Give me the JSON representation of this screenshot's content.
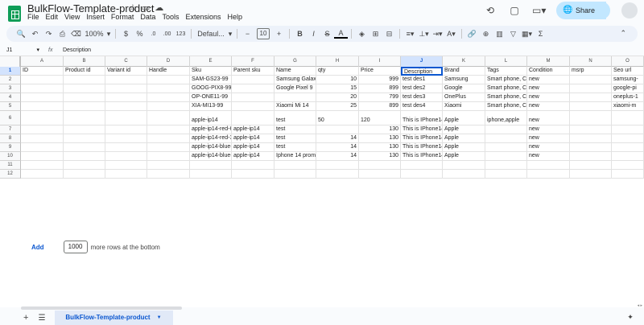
{
  "doc": {
    "title": "BulkFlow-Template-product",
    "menus": [
      "File",
      "Edit",
      "View",
      "Insert",
      "Format",
      "Data",
      "Tools",
      "Extensions",
      "Help"
    ]
  },
  "header": {
    "share_label": "Share"
  },
  "toolbar": {
    "zoom": "100%",
    "currency": "$",
    "percent": "%",
    "dec_dec": ".0",
    "dec_inc": ".00",
    "number_format": "123",
    "font": "Defaul...",
    "font_size": "10",
    "bold": "B",
    "italic": "I",
    "strike": "S",
    "text_color": "A"
  },
  "formula_bar": {
    "cell_ref": "J1",
    "fx": "fx",
    "value": "Description"
  },
  "grid": {
    "columns": [
      "A",
      "B",
      "C",
      "D",
      "E",
      "F",
      "G",
      "H",
      "I",
      "J",
      "K",
      "L",
      "M",
      "N",
      "O"
    ],
    "selected_col": "J",
    "row_numbers": [
      "1",
      "2",
      "3",
      "4",
      "5",
      "6",
      "7",
      "8",
      "9",
      "10",
      "11",
      "12"
    ],
    "selected_row": "1",
    "rows": [
      [
        "ID",
        "Product id",
        "Variant id",
        "Handle",
        "Sku",
        "Parent sku",
        "Name",
        "qty",
        "Price",
        "Description",
        "Brand",
        "Tags",
        "Condition",
        "msrp",
        "Seo url"
      ],
      [
        "",
        "",
        "",
        "",
        "SAM-GS23-99",
        "",
        "Samsung Galaxy",
        "10",
        "999",
        "test des1",
        "Samsung",
        "Smart phone, Ce",
        "new",
        "",
        "samsung-"
      ],
      [
        "",
        "",
        "",
        "",
        "GOOG-PIX8-99",
        "",
        "Google Pixel 9",
        "15",
        "899",
        "test des2",
        "Google",
        "Smart phone, Ce",
        "new",
        "",
        "google-pi"
      ],
      [
        "",
        "",
        "",
        "",
        "OP-ONE11-99",
        "",
        "",
        "20",
        "799",
        "test des3",
        "OnePlus",
        "Smart phone, Ce",
        "new",
        "",
        "oneplus-1"
      ],
      [
        "",
        "",
        "",
        "",
        "XIA-MI13-99",
        "",
        "Xiaomi Mi 14",
        "25",
        "899",
        "test des4",
        "Xiaomi",
        "Smart phone, Ce",
        "new",
        "",
        "xiaomi-m"
      ],
      [
        "",
        "",
        "",
        "",
        "apple-ip14",
        "",
        "test",
        "50",
        "120",
        "This is IPhone14",
        "Apple",
        "iphone,apple",
        "new",
        "",
        ""
      ],
      [
        "",
        "",
        "",
        "",
        "apple-ip14-red-6",
        "apple-ip14",
        "test",
        "",
        "130",
        "This is IPhone14",
        "Apple",
        "",
        "new",
        "",
        ""
      ],
      [
        "",
        "",
        "",
        "",
        "apple-ip14-red-3",
        "apple-ip14",
        "test",
        "14",
        "130",
        "This is IPhone14",
        "Apple",
        "",
        "new",
        "",
        ""
      ],
      [
        "",
        "",
        "",
        "",
        "apple-ip14-blue-",
        "apple-ip14",
        "test",
        "14",
        "130",
        "This is IPhone14",
        "Apple",
        "",
        "new",
        "",
        ""
      ],
      [
        "",
        "",
        "",
        "",
        "apple-ip14-blue-",
        "apple-ip14",
        "Iphone 14 proma",
        "14",
        "130",
        "This is IPhone14",
        "Apple",
        "",
        "new",
        "",
        ""
      ],
      [
        "",
        "",
        "",
        "",
        "",
        "",
        "",
        "",
        "",
        "",
        "",
        "",
        "",
        "",
        ""
      ],
      [
        "",
        "",
        "",
        "",
        "",
        "",
        "",
        "",
        "",
        "",
        "",
        "",
        "",
        "",
        ""
      ]
    ]
  },
  "add_rows": {
    "button_label": "Add",
    "count": "1000",
    "suffix": "more rows at the bottom"
  },
  "sheets": {
    "tabs": [
      "BulkFlow-Template-product"
    ]
  }
}
